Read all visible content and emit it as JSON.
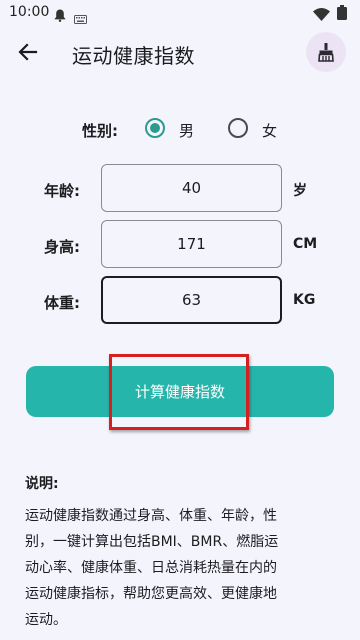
{
  "status_bar": {
    "time": "10:00",
    "icons": [
      "bell-icon",
      "keyboard-icon",
      "wifi-icon",
      "battery-icon"
    ]
  },
  "app_bar": {
    "title": "运动健康指数",
    "back_icon": "arrow-left-icon",
    "action_icon": "cleaning-brush-icon"
  },
  "form": {
    "gender": {
      "label": "性别:",
      "options": [
        {
          "label": "男",
          "selected": true
        },
        {
          "label": "女",
          "selected": false
        }
      ]
    },
    "age": {
      "label": "年龄:",
      "value": "40",
      "unit": "岁"
    },
    "height": {
      "label": "身高:",
      "value": "171",
      "unit": "CM"
    },
    "weight": {
      "label": "体重:",
      "value": "63",
      "unit": "KG"
    }
  },
  "calculate_button": {
    "label": "计算健康指数"
  },
  "description": {
    "title": "说明:",
    "lines": [
      "运动健康指数通过身高、体重、年龄，性",
      "别，一键计算出包括BMI、BMR、燃脂运",
      "动心率、健康体重、日总消耗热量在内的",
      "运动健康指标，帮助您更高效、更健康地",
      "运动。"
    ]
  },
  "colors": {
    "background": "#f4f4fc",
    "accent": "#26b5aa",
    "radio_selected": "#2b9b8f",
    "highlight": "#d61f1f",
    "action_button_bg": "#ece4f4"
  }
}
